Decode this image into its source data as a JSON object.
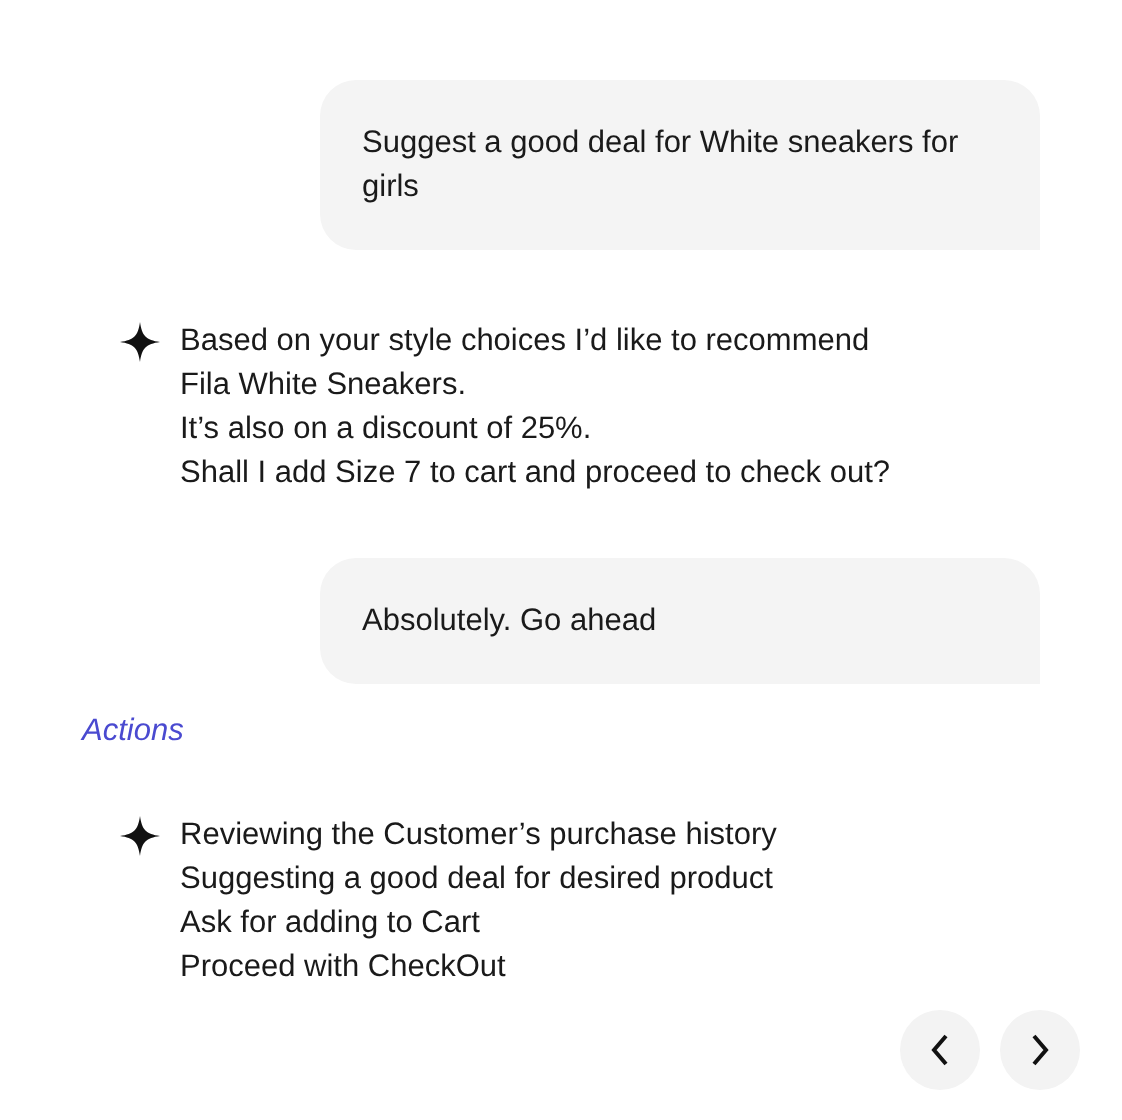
{
  "messages": [
    {
      "kind": "user",
      "text": "Suggest a good deal for White sneakers for girls"
    },
    {
      "kind": "assistant",
      "lines": [
        "Based on your style choices I’d like to recommend",
        "Fila White Sneakers.",
        "It’s also on a discount of 25%.",
        "Shall I add Size 7 to cart and proceed to check out?"
      ]
    },
    {
      "kind": "user",
      "text": "Absolutely. Go ahead"
    },
    {
      "kind": "label",
      "text": "Actions"
    },
    {
      "kind": "assistant",
      "lines": [
        "Reviewing the Customer’s purchase history",
        "Suggesting a good deal for desired product",
        "Ask for adding to Cart",
        "Proceed with CheckOut"
      ]
    }
  ]
}
